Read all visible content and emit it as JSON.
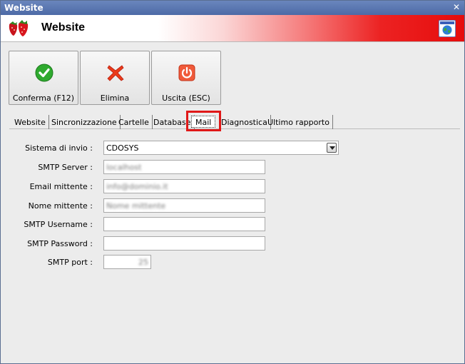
{
  "window": {
    "title": "Website"
  },
  "header": {
    "title": "Website"
  },
  "toolbar": {
    "confirm_label": "Conferma (F12)",
    "delete_label": "Elimina",
    "exit_label": "Uscita (ESC)"
  },
  "tabs": [
    {
      "label": "Website"
    },
    {
      "label": "Sincronizzazione"
    },
    {
      "label": "Cartelle"
    },
    {
      "label": "Database"
    },
    {
      "label": "Mail"
    },
    {
      "label": "Diagnostica"
    },
    {
      "label": "Ultimo rapporto"
    }
  ],
  "active_tab": "Mail",
  "form": {
    "send_system_label": "Sistema di invio :",
    "send_system_value": "CDOSYS",
    "smtp_server_label": "SMTP Server :",
    "smtp_server_value": "localhost",
    "email_sender_label": "Email mittente :",
    "email_sender_value": "info@dominio.it",
    "sender_name_label": "Nome mittente :",
    "sender_name_value": "Nome mittente",
    "smtp_username_label": "SMTP Username :",
    "smtp_username_value": "",
    "smtp_password_label": "SMTP Password :",
    "smtp_password_value": "",
    "smtp_port_label": "SMTP port :",
    "smtp_port_value": "25"
  },
  "colors": {
    "highlight": "#e01818",
    "titlebar": "#5a76ad",
    "header_gradient_end": "#e60c0c"
  },
  "icons": [
    "strawberry-logo-icon",
    "globe-icon",
    "checkmark-icon",
    "red-x-icon",
    "power-icon",
    "close-icon",
    "chevron-down-icon"
  ]
}
